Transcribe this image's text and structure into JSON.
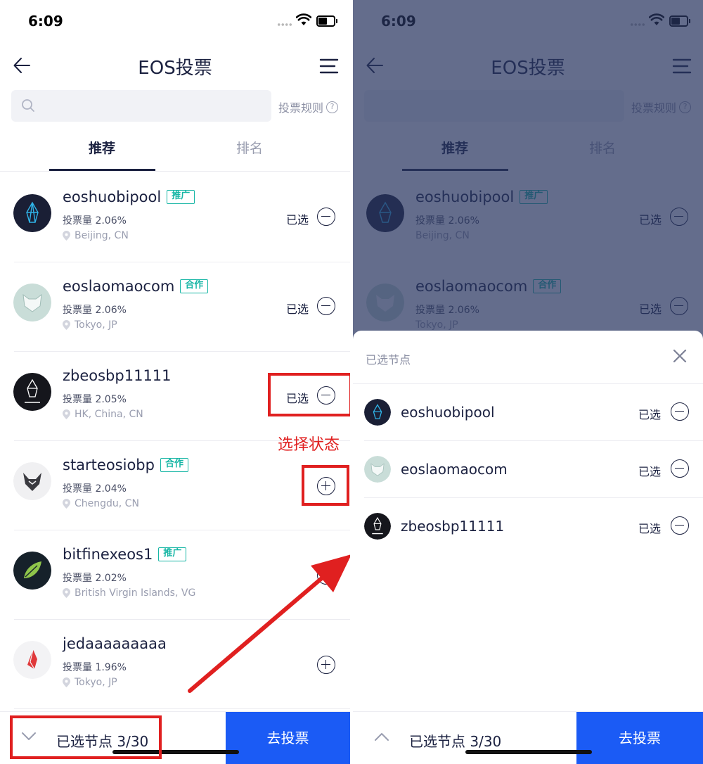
{
  "status_bar": {
    "time": "6:09"
  },
  "header": {
    "title": "EOS投票"
  },
  "search": {
    "placeholder": "",
    "rules_label": "投票规则",
    "help_glyph": "?"
  },
  "tabs": [
    {
      "label": "推荐"
    },
    {
      "label": "排名"
    }
  ],
  "nodes": [
    {
      "name": "eoshuobipool",
      "tag": "推广",
      "votes": "投票量 2.06%",
      "location": "Beijing, CN",
      "selected": true,
      "action_label": "已选",
      "avatar": "eos-logo-avatar"
    },
    {
      "name": "eoslaomaocom",
      "tag": "合作",
      "votes": "投票量 2.06%",
      "location": "Tokyo, JP",
      "selected": true,
      "action_label": "已选",
      "avatar": "cat-avatar"
    },
    {
      "name": "zbeosbp11111",
      "tag": "",
      "votes": "投票量 2.05%",
      "location": "HK, China, CN",
      "selected": true,
      "action_label": "已选",
      "avatar": "zb-eos-avatar"
    },
    {
      "name": "starteosiobp",
      "tag": "合作",
      "votes": "投票量 2.04%",
      "location": "Chengdu, CN",
      "selected": false,
      "action_label": "",
      "avatar": "wolf-avatar"
    },
    {
      "name": "bitfinexeos1",
      "tag": "推广",
      "votes": "投票量 2.02%",
      "location": "British Virgin Islands, VG",
      "selected": false,
      "action_label": "",
      "avatar": "leaf-avatar"
    },
    {
      "name": "jedaaaaaaaaa",
      "tag": "",
      "votes": "投票量 1.96%",
      "location": "Tokyo, JP",
      "selected": false,
      "action_label": "",
      "avatar": "red-logo-avatar"
    }
  ],
  "bottom_bar": {
    "selected_count": "已选节点 3/30",
    "vote_button": "去投票"
  },
  "annotation": {
    "text": "选择状态",
    "color": "#e02020"
  },
  "sheet": {
    "title": "已选节点",
    "items": [
      {
        "name": "eoshuobipool",
        "action_label": "已选"
      },
      {
        "name": "eoslaomaocom",
        "action_label": "已选"
      },
      {
        "name": "zbeosbp11111",
        "action_label": "已选"
      }
    ]
  },
  "colors": {
    "accent": "#1b5bf5",
    "tag": "#17b6a5",
    "text": "#1b2140",
    "annotation": "#e02020"
  }
}
